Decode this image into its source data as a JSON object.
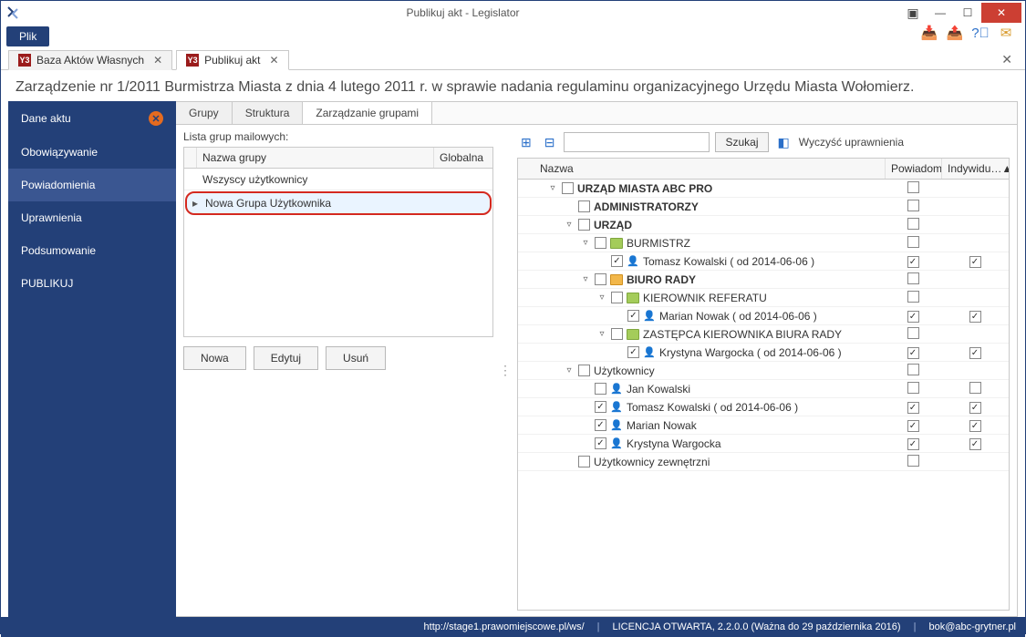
{
  "window": {
    "title": "Publikuj akt - Legislator"
  },
  "menu": {
    "file": "Plik"
  },
  "doc_tabs": [
    {
      "label": "Baza Aktów Własnych",
      "active": false
    },
    {
      "label": "Publikuj akt",
      "active": true
    }
  ],
  "heading": "Zarządzenie nr 1/2011 Burmistrza Miasta z dnia 4 lutego 2011 r. w sprawie nadania regulaminu organizacyjnego Urzędu Miasta Wołomierz.",
  "sidebar": {
    "items": [
      "Dane aktu",
      "Obowiązywanie",
      "Powiadomienia",
      "Uprawnienia",
      "Podsumowanie",
      "PUBLIKUJ"
    ],
    "active_index": 2
  },
  "inner_tabs": [
    {
      "label": "Grupy"
    },
    {
      "label": "Struktura"
    },
    {
      "label": "Zarządzanie grupami",
      "active": true
    }
  ],
  "groups_panel": {
    "title": "Lista grup mailowych:",
    "columns": {
      "name": "Nazwa grupy",
      "global": "Globalna"
    },
    "rows": [
      {
        "name": "Wszyscy użytkownicy",
        "global": false,
        "highlight": false
      },
      {
        "name": "Nowa Grupa Użytkownika",
        "global": false,
        "highlight": true,
        "marker": "▸"
      }
    ],
    "buttons": {
      "new": "Nowa",
      "edit": "Edytuj",
      "delete": "Usuń"
    }
  },
  "toolbar": {
    "search_placeholder": "",
    "search_btn": "Szukaj",
    "clear_label": "Wyczyść uprawnienia"
  },
  "tree": {
    "columns": {
      "name": "Nazwa",
      "notify": "Powiadom",
      "indiv": "Indywidu…"
    },
    "rows": [
      {
        "depth": 0,
        "exp": "▿",
        "cb": false,
        "text": "URZĄD MIASTA ABC PRO",
        "bold": true,
        "notify": false,
        "indiv": null
      },
      {
        "depth": 1,
        "exp": "",
        "cb": false,
        "text": "ADMINISTRATORZY",
        "bold": true,
        "notify": false,
        "indiv": null
      },
      {
        "depth": 1,
        "exp": "▿",
        "cb": false,
        "text": "URZĄD",
        "bold": true,
        "notify": false,
        "indiv": null
      },
      {
        "depth": 2,
        "exp": "▿",
        "cb": false,
        "icon": "folder",
        "text": "BURMISTRZ",
        "notify": false,
        "indiv": null
      },
      {
        "depth": 3,
        "exp": "",
        "cb": true,
        "icon": "user",
        "text": "Tomasz Kowalski ( od 2014-06-06 )",
        "notify": true,
        "indiv": true
      },
      {
        "depth": 2,
        "exp": "▿",
        "cb": false,
        "icon": "folder-o",
        "text": "BIURO RADY",
        "bold": true,
        "notify": false,
        "indiv": null
      },
      {
        "depth": 3,
        "exp": "▿",
        "cb": false,
        "icon": "folder",
        "text": "KIEROWNIK REFERATU",
        "notify": false,
        "indiv": null
      },
      {
        "depth": 4,
        "exp": "",
        "cb": true,
        "icon": "user",
        "text": "Marian Nowak ( od 2014-06-06 )",
        "notify": true,
        "indiv": true
      },
      {
        "depth": 3,
        "exp": "▿",
        "cb": false,
        "icon": "folder",
        "text": "ZASTĘPCA KIEROWNIKA BIURA RADY",
        "notify": false,
        "indiv": null
      },
      {
        "depth": 4,
        "exp": "",
        "cb": true,
        "icon": "user",
        "text": "Krystyna Wargocka ( od 2014-06-06 )",
        "notify": true,
        "indiv": true
      },
      {
        "depth": 1,
        "exp": "▿",
        "cb": false,
        "text": "Użytkownicy",
        "notify": false,
        "indiv": null
      },
      {
        "depth": 2,
        "exp": "",
        "cb": false,
        "icon": "user",
        "text": "Jan Kowalski",
        "notify": false,
        "indiv": false
      },
      {
        "depth": 2,
        "exp": "",
        "cb": true,
        "icon": "user",
        "text": "Tomasz Kowalski ( od 2014-06-06 )",
        "notify": true,
        "indiv": true
      },
      {
        "depth": 2,
        "exp": "",
        "cb": true,
        "icon": "user",
        "text": "Marian Nowak",
        "notify": true,
        "indiv": true
      },
      {
        "depth": 2,
        "exp": "",
        "cb": true,
        "icon": "user",
        "text": "Krystyna Wargocka",
        "notify": true,
        "indiv": true
      },
      {
        "depth": 1,
        "exp": "",
        "cb": false,
        "text": "Użytkownicy zewnętrzni",
        "notify": false,
        "indiv": null
      }
    ]
  },
  "footer": {
    "url": "http://stage1.prawomiejscowe.pl/ws/",
    "license": "LICENCJA OTWARTA, 2.2.0.0 (Ważna do 29 października 2016)",
    "email": "bok@abc-grytner.pl"
  }
}
